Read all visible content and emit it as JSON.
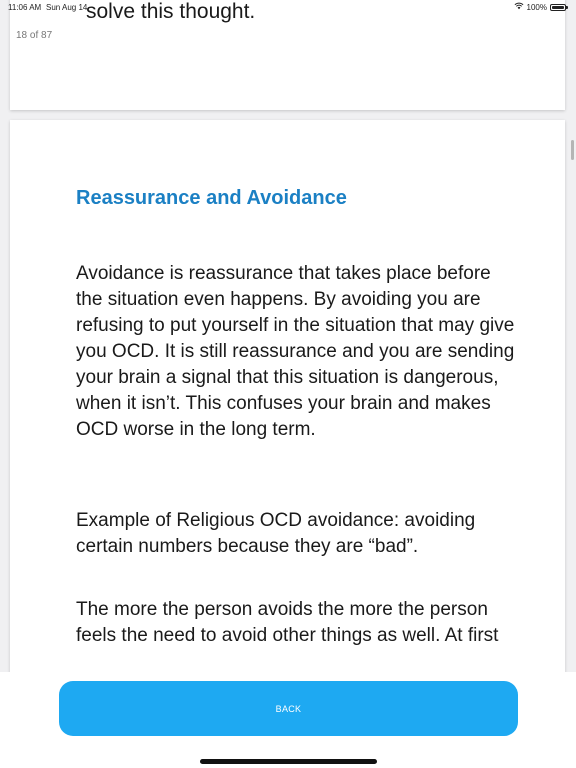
{
  "status_bar": {
    "time": "11:06 AM",
    "date": "Sun Aug 14",
    "battery": "100%",
    "wifi_icon": "wifi-icon",
    "battery_icon": "battery-icon"
  },
  "previous_card": {
    "page_counter": "18 of 87",
    "text": "feel, what if I did? I better think about it to try and solve this thought."
  },
  "main_card": {
    "title": "Reassurance and Avoidance",
    "paragraphs": [
      "Avoidance is reassurance that takes place before the situation even happens. By avoiding you are refusing to put yourself in the situation that may give you OCD. It is still reassurance and you are sending your brain a signal that this situation is dangerous, when it isn’t. This confuses your brain and makes OCD worse in the long term.",
      "Example of Religious OCD avoidance: avoiding certain numbers because they are “bad”.",
      "The more the person avoids the more the person feels the need to avoid other things as well. At first"
    ]
  },
  "footer": {
    "back_label": "BACK"
  },
  "colors": {
    "accent": "#1b80c4",
    "button": "#1ea9f2",
    "background": "#f0f0f2"
  }
}
